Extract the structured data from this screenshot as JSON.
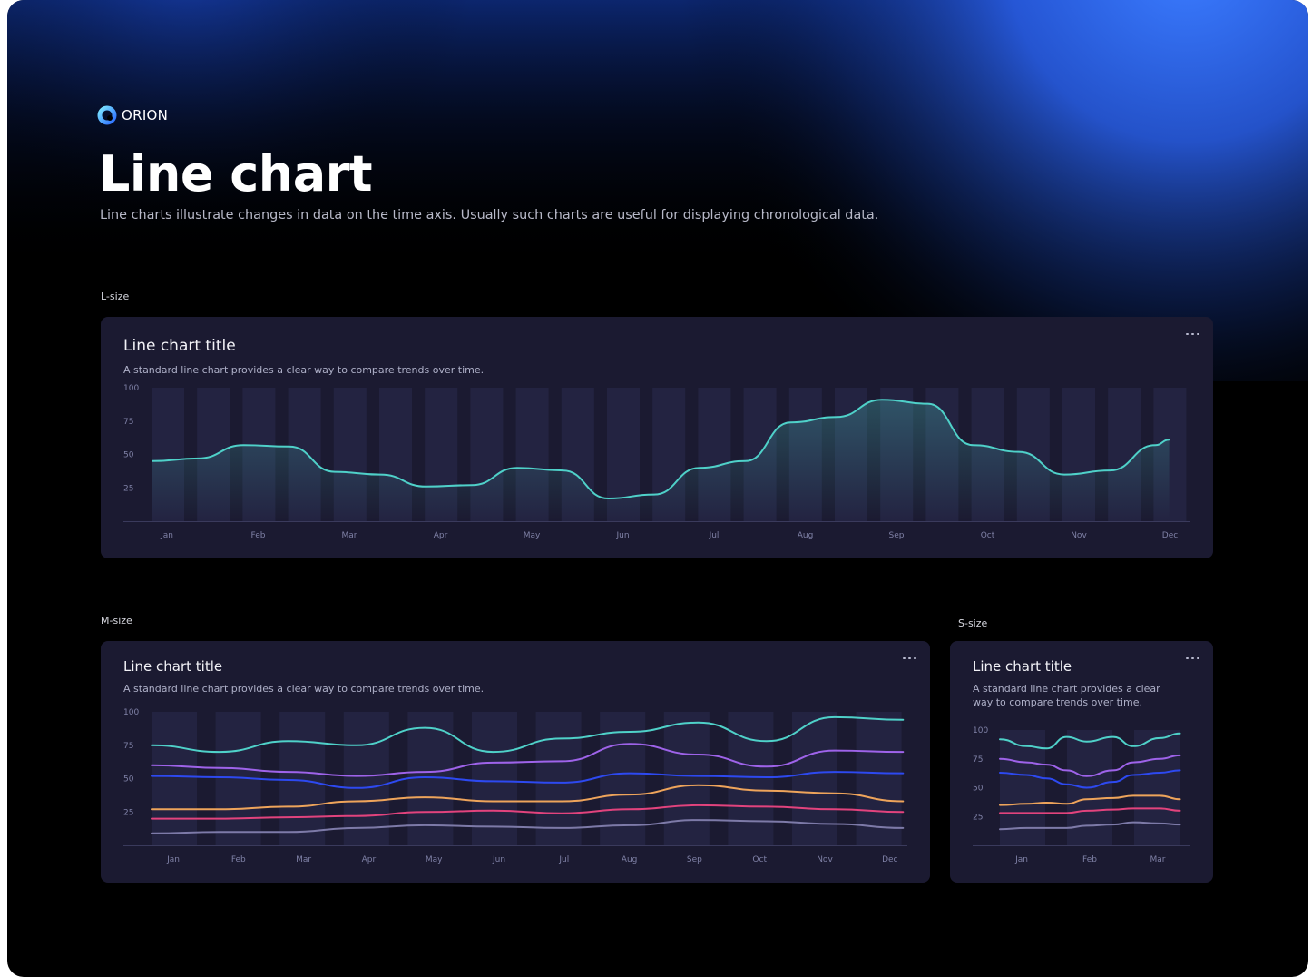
{
  "brand": {
    "name": "ORION"
  },
  "page": {
    "title": "Line chart",
    "description": "Line charts illustrate changes in data on the time axis. Usually such charts are useful for displaying chronological data."
  },
  "sections": {
    "l_label": "L-size",
    "m_label": "M-size",
    "s_label": "S-size"
  },
  "cards": {
    "l": {
      "title": "Line chart title",
      "subtitle": "A standard line chart provides a clear way to compare trends over time."
    },
    "m": {
      "title": "Line chart title",
      "subtitle": "A standard line chart provides a clear way to compare trends over time."
    },
    "s": {
      "title": "Line chart title",
      "subtitle": "A standard line chart provides a clear way to compare trends over time."
    }
  },
  "colors": {
    "background": "#000000",
    "glow": "#2f6ff5",
    "card": "#1b1a31",
    "column_band": "#232341",
    "teal": "#4fd1c9",
    "purple": "#9e63e9",
    "blue": "#2d49f0",
    "orange": "#eea45b",
    "pink": "#e2437d",
    "gray": "#7d7aa8"
  },
  "chart_data": [
    {
      "type": "area",
      "title": "Line chart title",
      "subtitle": "A standard line chart provides a clear way to compare trends over time.",
      "categories": [
        "Jan",
        "Feb",
        "Mar",
        "Apr",
        "May",
        "Jun",
        "Jul",
        "Aug",
        "Sep",
        "Oct",
        "Nov",
        "Dec"
      ],
      "y_ticks": [
        25,
        50,
        75,
        100
      ],
      "ylim": [
        0,
        100
      ],
      "grid": "vertical column bands",
      "series": [
        {
          "color": "#4fd1c9",
          "x": [
            0,
            0.5,
            1,
            1.5,
            2,
            2.5,
            3,
            3.5,
            4,
            4.5,
            5,
            5.5,
            6,
            6.5,
            7,
            7.5,
            8,
            8.5,
            9,
            9.5,
            10,
            10.5,
            11,
            11.15
          ],
          "values": [
            45,
            47,
            57,
            56,
            37,
            35,
            26,
            27,
            40,
            38,
            17,
            20,
            40,
            45,
            74,
            78,
            91,
            88,
            57,
            52,
            35,
            38,
            57,
            61
          ]
        }
      ]
    },
    {
      "type": "line",
      "title": "Line chart title",
      "subtitle": "A standard line chart provides a clear way to compare trends over time.",
      "categories": [
        "Jan",
        "Feb",
        "Mar",
        "Apr",
        "May",
        "Jun",
        "Jul",
        "Aug",
        "Sep",
        "Oct",
        "Nov",
        "Dec"
      ],
      "y_ticks": [
        25,
        50,
        75,
        100
      ],
      "ylim": [
        0,
        100
      ],
      "series": [
        {
          "color": "#4fd1c9",
          "values": [
            75,
            70,
            78,
            75,
            88,
            70,
            80,
            85,
            92,
            78,
            96,
            94
          ]
        },
        {
          "color": "#9e63e9",
          "values": [
            60,
            58,
            55,
            52,
            55,
            62,
            63,
            76,
            68,
            59,
            71,
            70
          ]
        },
        {
          "color": "#2d49f0",
          "values": [
            52,
            51,
            49,
            43,
            51,
            48,
            47,
            54,
            52,
            51,
            55,
            54
          ]
        },
        {
          "color": "#eea45b",
          "values": [
            27,
            27,
            29,
            33,
            36,
            33,
            33,
            38,
            45,
            41,
            39,
            33
          ]
        },
        {
          "color": "#e2437d",
          "values": [
            20,
            20,
            21,
            22,
            25,
            26,
            24,
            27,
            30,
            29,
            27,
            25
          ]
        },
        {
          "color": "#7d7aa8",
          "values": [
            9,
            10,
            10,
            13,
            15,
            14,
            13,
            15,
            19,
            18,
            16,
            13
          ]
        }
      ]
    },
    {
      "type": "line",
      "title": "Line chart title",
      "subtitle": "A standard line chart provides a clear way to compare trends over time.",
      "categories": [
        "Jan",
        "Feb",
        "Mar"
      ],
      "y_ticks": [
        25,
        50,
        75,
        100
      ],
      "ylim": [
        0,
        100
      ],
      "series": [
        {
          "color": "#4fd1c9",
          "x": [
            0,
            0.4,
            0.7,
            1,
            1.3,
            1.7,
            2,
            2.4,
            2.7
          ],
          "values": [
            92,
            86,
            84,
            94,
            90,
            94,
            86,
            93,
            97
          ]
        },
        {
          "color": "#9e63e9",
          "x": [
            0,
            0.4,
            0.7,
            1,
            1.3,
            1.7,
            2,
            2.4,
            2.7
          ],
          "values": [
            75,
            72,
            70,
            65,
            60,
            65,
            72,
            75,
            78
          ]
        },
        {
          "color": "#2d49f0",
          "x": [
            0,
            0.4,
            0.7,
            1,
            1.3,
            1.7,
            2,
            2.4,
            2.7
          ],
          "values": [
            63,
            61,
            58,
            53,
            50,
            55,
            61,
            63,
            65
          ]
        },
        {
          "color": "#eea45b",
          "x": [
            0,
            0.4,
            0.7,
            1,
            1.3,
            1.7,
            2,
            2.4,
            2.7
          ],
          "values": [
            35,
            36,
            37,
            36,
            40,
            41,
            43,
            43,
            40
          ]
        },
        {
          "color": "#e2437d",
          "x": [
            0,
            0.4,
            0.7,
            1,
            1.3,
            1.7,
            2,
            2.4,
            2.7
          ],
          "values": [
            28,
            28,
            28,
            28,
            30,
            31,
            32,
            32,
            30
          ]
        },
        {
          "color": "#7d7aa8",
          "x": [
            0,
            0.4,
            0.7,
            1,
            1.3,
            1.7,
            2,
            2.4,
            2.7
          ],
          "values": [
            14,
            15,
            15,
            15,
            17,
            18,
            20,
            19,
            18
          ]
        }
      ]
    }
  ]
}
